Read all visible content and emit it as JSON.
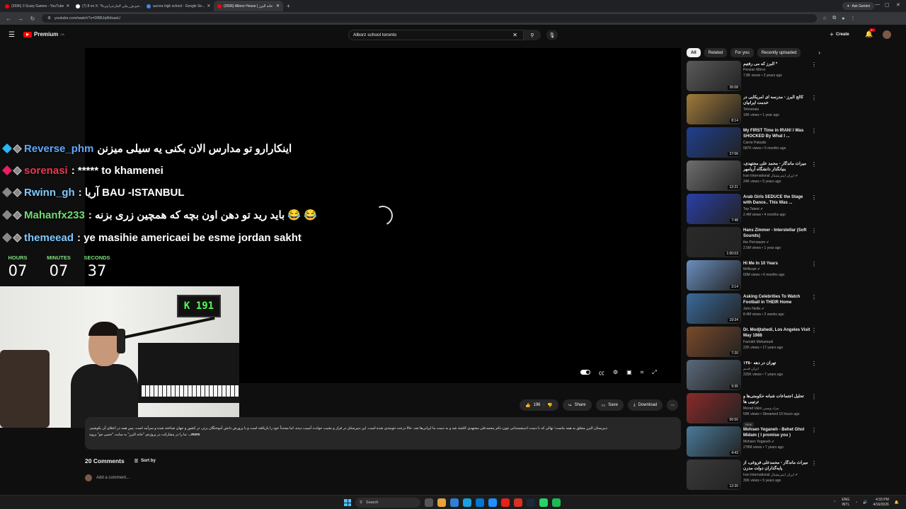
{
  "browser": {
    "tabs": [
      {
        "label": "(3596) 3 Scary Games - YouTube",
        "color": "#ff0000"
      },
      {
        "label": "(7) 8 on X: \"#خیزش_ملی #مازندرانیزه...",
        "color": "#ffffff"
      },
      {
        "label": "aurora high school - Google Se...",
        "color": "#4285f4"
      },
      {
        "label": "(3596) Alborz House | خانه البرز",
        "color": "#ff0000",
        "active": true
      }
    ],
    "new_tab_icon": "plus-icon",
    "ask_gemini": "Ask Gemini",
    "url": "youtube.com/watch?v=DBBJqRdvasU"
  },
  "youtube": {
    "logo_text": "Premium",
    "logo_region": "CA",
    "search_value": "Alborz school toronto",
    "create_label": "Create",
    "notification_count": "9+"
  },
  "overlay": {
    "chat": [
      {
        "user": "Reverse_phm",
        "message": "اینکارارو تو مدارس الان بکنی یه سیلی میزنن",
        "user_color": "#5ea8ff",
        "badge_color": "#29b6f6"
      },
      {
        "user": "sorenasi",
        "message": ": ***** to khamenei",
        "user_color": "#e8384f",
        "badge_color": "#e91e63"
      },
      {
        "user": "Rwinn_gh",
        "message": ": آریا BAU -ISTANBUL",
        "user_color": "#7ec8ff",
        "badge_color": "#888888"
      },
      {
        "user": "Mahanfx233",
        "message": ": باید رید تو دهن اون بچه که همچین زری بزنه 😂 😂",
        "user_color": "#6fdc6f",
        "badge_color": "#888888"
      },
      {
        "user": "themeead",
        "message": ": ye masihie americaei be esme jordan sakht",
        "user_color": "#7ec8ff",
        "badge_color": "#888888"
      }
    ],
    "timer": {
      "hours_label": "HOURS",
      "hours": "07",
      "minutes_label": "MINUTES",
      "minutes": "07",
      "seconds_label": "SECONDS",
      "seconds": "37"
    },
    "webcam_sign": "K 191"
  },
  "actions": {
    "likes": "196",
    "share": "Share",
    "save": "Save",
    "download": "Download"
  },
  "description": {
    "line1": "دبیرستان البرز متعلق به همه ماست؛ نهالی که با دست اندیشمندانی چون دکتر محمدعلی مجتهدی کاشته شد و به دست ما ایرانی‌ها شد. حالا درخت تنومندی شده است. این دبیرستان در فراز و نشیب حوادث آسیب دیده، اما مجدداً خود را بازیافته است و با پرورش دانش آموختگان برتر، در کشور و جهان شناخته شده و سرآمد است. پس همه در اعتلای آن بکوشیم.",
    "line2": "ما را در مشارکت در پروژه‌ی \"خانه البرز\" به سایت \"حتمی جو\" بروید:",
    "more": "...more"
  },
  "comments": {
    "count_label": "20 Comments",
    "sort_label": "Sort by",
    "add_placeholder": "Add a comment..."
  },
  "chips": [
    "All",
    "Related",
    "For you",
    "Recently uploaded"
  ],
  "recommendations": [
    {
      "title": "البرز که می رفتیم *",
      "channel": "Persian Mirror",
      "verified": false,
      "meta": "7.8K views • 2 years ago",
      "duration": "26:08",
      "thumb": "#5a5a5a"
    },
    {
      "title": "کالج البرز - مدرسه ای آمریکایی در خدمت ایرانیان",
      "channel": "Tehranaia",
      "verified": false,
      "meta": "19K views • 1 year ago",
      "duration": "8:14",
      "thumb": "#a07a3a"
    },
    {
      "title": "My FIRST Time in IRAN! I Was SHOCKED By What I ...",
      "channel": "Carrie Patsalis",
      "verified": false,
      "meta": "587K views • 5 months ago",
      "duration": "27:06",
      "thumb": "#1f3f8f"
    },
    {
      "title": "میراث ماندگار - محمد علی مجتهدی، بنیانگذار دانشگاه آریامهر",
      "channel": "Iran International ایران اینترنشنال",
      "verified": true,
      "meta": "24K views • 5 years ago",
      "duration": "12:21",
      "thumb": "#6e6e6e"
    },
    {
      "title": "Arab Girls SEDUCE the Stage with Dance.. This Was ...",
      "channel": "Top Talent",
      "verified": true,
      "meta": "2.4M views • 4 months ago",
      "duration": "7:48",
      "thumb": "#2a3fa8"
    },
    {
      "title": "Hans Zimmer - Interstellar (Soft Sounds)",
      "channel": "the Pernasam",
      "verified": true,
      "meta": "2.5M views • 1 year ago",
      "duration": "1:00:03",
      "thumb": "#2a2a2a"
    },
    {
      "title": "Hi Me In 10 Years",
      "channel": "MrBeast",
      "verified": true,
      "meta": "60M views • 6 months ago",
      "duration": "3:14",
      "thumb": "#6a8fbf"
    },
    {
      "title": "Asking Celebrities To Watch Football in THEIR Home",
      "channel": "John Nellis",
      "verified": true,
      "meta": "8.4M views • 2 weeks ago",
      "duration": "19:34",
      "thumb": "#3a6a9a"
    },
    {
      "title": "Dr. Modjtahedi, Los Angeles Visit May 1988",
      "channel": "Farrokh Mohamadi",
      "verified": false,
      "meta": "22K views • 17 years ago",
      "duration": "7:20",
      "thumb": "#7a4a2a"
    },
    {
      "title": "تهران در دهه ۱۳۵۰",
      "channel": "ایران قدیم",
      "verified": false,
      "meta": "225K views • 7 years ago",
      "duration": "9:35",
      "thumb": "#5a6a7a"
    },
    {
      "title": "تحلیل اجتماعات شبانه حکومتی‌ها و ترتیبی ها",
      "channel": "Morad Vaisi مراد ویسی",
      "verified": false,
      "meta": "59K views • Streamed 10 hours ago",
      "duration": "56:50",
      "thumb": "#8a2a2a",
      "badge": "New"
    },
    {
      "title": "Mohsen Yeganeh - Behet Ghol Midam ( I promise you )",
      "channel": "Mohsen Yeganeh",
      "verified": true,
      "meta": "278M views • 7 years ago",
      "duration": "4:43",
      "thumb": "#4a7a9a"
    },
    {
      "title": "میراث ماندگار - محمدعلی فروغی، از پایه‌گذاران دولت مدرن",
      "channel": "Iran International ایران اینترنشنال",
      "verified": true,
      "meta": "30K views • 5 years ago",
      "duration": "12:20",
      "thumb": "#3a3a3a"
    }
  ],
  "taskbar": {
    "search_label": "Search",
    "lang_top": "ENG",
    "lang_bottom": "INTL",
    "time": "4:33 PM",
    "date": "4/16/2026"
  }
}
